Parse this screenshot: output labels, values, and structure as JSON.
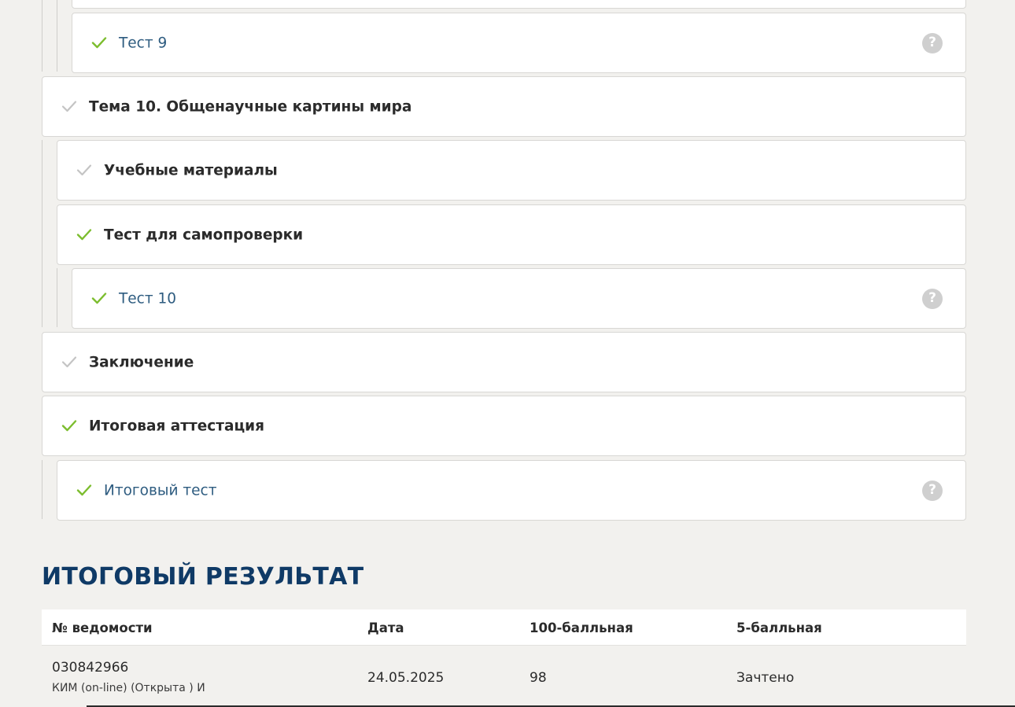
{
  "course_items": [
    {
      "id": "test-9",
      "level": 2,
      "title": "Тест 9",
      "kind": "link",
      "check": "green",
      "help": "?"
    },
    {
      "id": "topic-10",
      "level": 0,
      "title": "Тема 10. Общенаучные картины мира",
      "kind": "section",
      "check": "gray"
    },
    {
      "id": "materials-10",
      "level": 1,
      "title": "Учебные материалы",
      "kind": "section",
      "check": "gray"
    },
    {
      "id": "selftest-10",
      "level": 1,
      "title": "Тест для самопроверки",
      "kind": "section",
      "check": "green"
    },
    {
      "id": "test-10",
      "level": 2,
      "title": "Тест 10",
      "kind": "link",
      "check": "green",
      "help": "?"
    },
    {
      "id": "conclusion",
      "level": 0,
      "title": "Заключение",
      "kind": "section",
      "check": "gray"
    },
    {
      "id": "final-attestation",
      "level": 0,
      "title": "Итоговая аттестация",
      "kind": "section",
      "check": "green"
    },
    {
      "id": "final-test",
      "level": 1,
      "title": "Итоговый тест",
      "kind": "link",
      "check": "green",
      "help": "?"
    }
  ],
  "final_result": {
    "title": "ИТОГОВЫЙ РЕЗУЛЬТАТ",
    "columns": {
      "sheet": "№ ведомости",
      "date": "Дата",
      "score100": "100-балльная",
      "score5": "5-балльная"
    },
    "rows": [
      {
        "sheet": "030842966",
        "sheet_note": "КИМ (on-line) (Открыта ) И",
        "date": "24.05.2025",
        "score100": "98",
        "score5": "Зачтено"
      }
    ]
  },
  "colors": {
    "check_green": "#7cbd2e",
    "check_gray": "#c4c4c4",
    "link": "#2e5c80",
    "heading": "#0f3a66"
  }
}
